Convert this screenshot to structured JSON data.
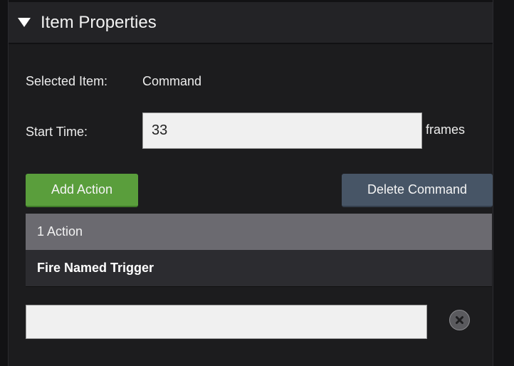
{
  "panel": {
    "title": "Item Properties"
  },
  "fields": {
    "selected_item_label": "Selected Item:",
    "selected_item_value": "Command",
    "start_time_label": "Start Time:",
    "start_time_value": "33",
    "start_time_unit": "frames"
  },
  "buttons": {
    "add_action": "Add Action",
    "delete_command": "Delete Command"
  },
  "actions": {
    "header": "1 Action",
    "items": [
      "Fire Named Trigger"
    ]
  },
  "trigger_name_input": {
    "value": ""
  },
  "icons": {
    "collapse": "triangle-down-icon",
    "clear": "close-circle-icon"
  },
  "colors": {
    "add_button": "#5a9e3c",
    "delete_button": "#475566",
    "list_header": "#6b6a70"
  }
}
